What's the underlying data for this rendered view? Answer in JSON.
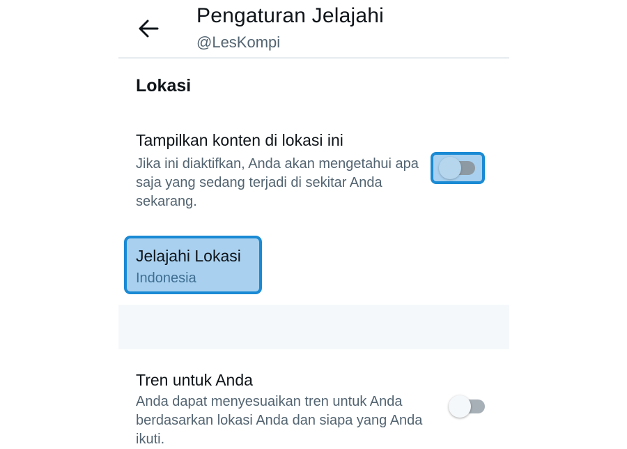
{
  "header": {
    "title": "Pengaturan Jelajahi",
    "subtitle": "@LesKompi",
    "back_icon": "arrow-left-icon"
  },
  "location_section": {
    "title": "Lokasi",
    "show_local_content": {
      "title": "Tampilkan konten di lokasi ini",
      "description": "Jika ini diaktifkan, Anda akan mengetahui apa saja yang sedang terjadi di sekitar Anda sekarang.",
      "enabled": false
    },
    "explore_location": {
      "title": "Jelajahi Lokasi",
      "value": "Indonesia"
    }
  },
  "trends_section": {
    "title": "Tren untuk Anda",
    "description": "Anda dapat menyesuaikan tren untuk Anda berdasarkan lokasi Anda dan siapa yang Anda ikuti.",
    "enabled": false
  },
  "colors": {
    "highlight_fill": "#a9d1ef",
    "highlight_border": "#1a8ad4",
    "secondary_text": "#536471",
    "divider_band": "#f5f8fa"
  }
}
